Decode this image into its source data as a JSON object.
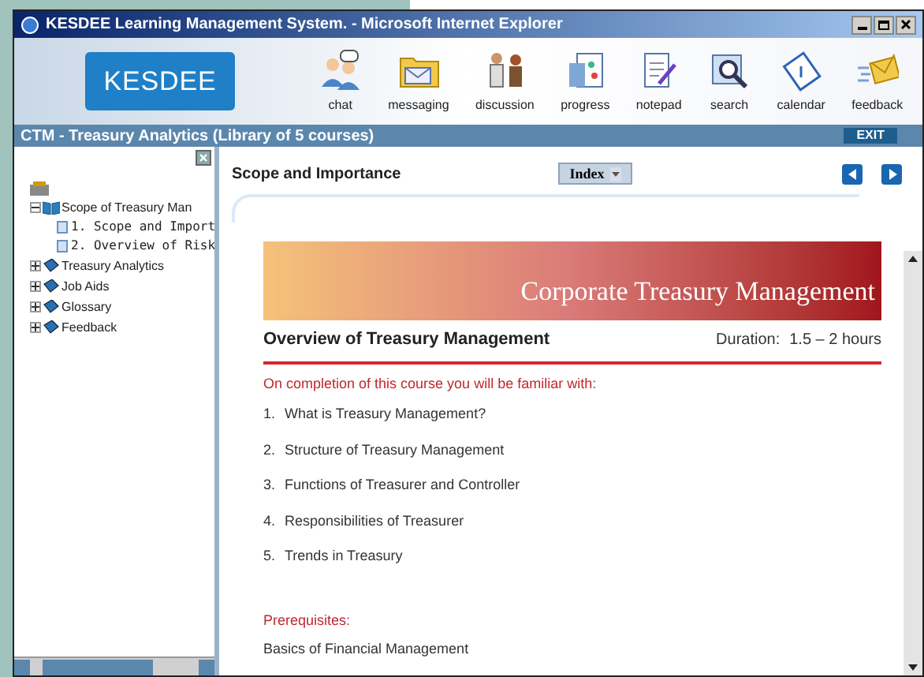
{
  "window": {
    "title": "KESDEE Learning Management System. - Microsoft Internet Explorer"
  },
  "logo": {
    "text": "KESDEE"
  },
  "toolbar": [
    {
      "label": "chat"
    },
    {
      "label": "messaging"
    },
    {
      "label": "discussion"
    },
    {
      "label": "progress"
    },
    {
      "label": "notepad"
    },
    {
      "label": "search"
    },
    {
      "label": "calendar"
    },
    {
      "label": "feedback"
    }
  ],
  "course_bar": {
    "title": "CTM - Treasury Analytics (Library of 5 courses)",
    "exit": "EXIT"
  },
  "tree": [
    {
      "label": "Scope of Treasury Man",
      "expanded": true,
      "children": [
        {
          "label": "1. Scope and Import"
        },
        {
          "label": "2. Overview of Risk"
        }
      ]
    },
    {
      "label": "Treasury Analytics",
      "expanded": false
    },
    {
      "label": "Job Aids",
      "expanded": false
    },
    {
      "label": "Glossary",
      "expanded": false
    },
    {
      "label": "Feedback",
      "expanded": false
    }
  ],
  "page": {
    "heading": "Scope and Importance",
    "index_button": "Index",
    "banner_title": "Corporate Treasury Management",
    "course_title": "Overview of Treasury Management",
    "duration_label": "Duration:",
    "duration": "1.5 – 2 hours",
    "intro": "On completion of this course you will be familiar with:",
    "topics": [
      {
        "number": "1.",
        "text": "What is Treasury Management?"
      },
      {
        "number": "2.",
        "text": "Structure of Treasury Management"
      },
      {
        "number": "3.",
        "text": "Functions of Treasurer and Controller"
      },
      {
        "number": "4.",
        "text": "Responsibilities of Treasurer"
      },
      {
        "number": "5.",
        "text": "Trends in Treasury"
      }
    ],
    "prereq_label": "Prerequisites:",
    "prereq": "Basics of Financial Management"
  }
}
